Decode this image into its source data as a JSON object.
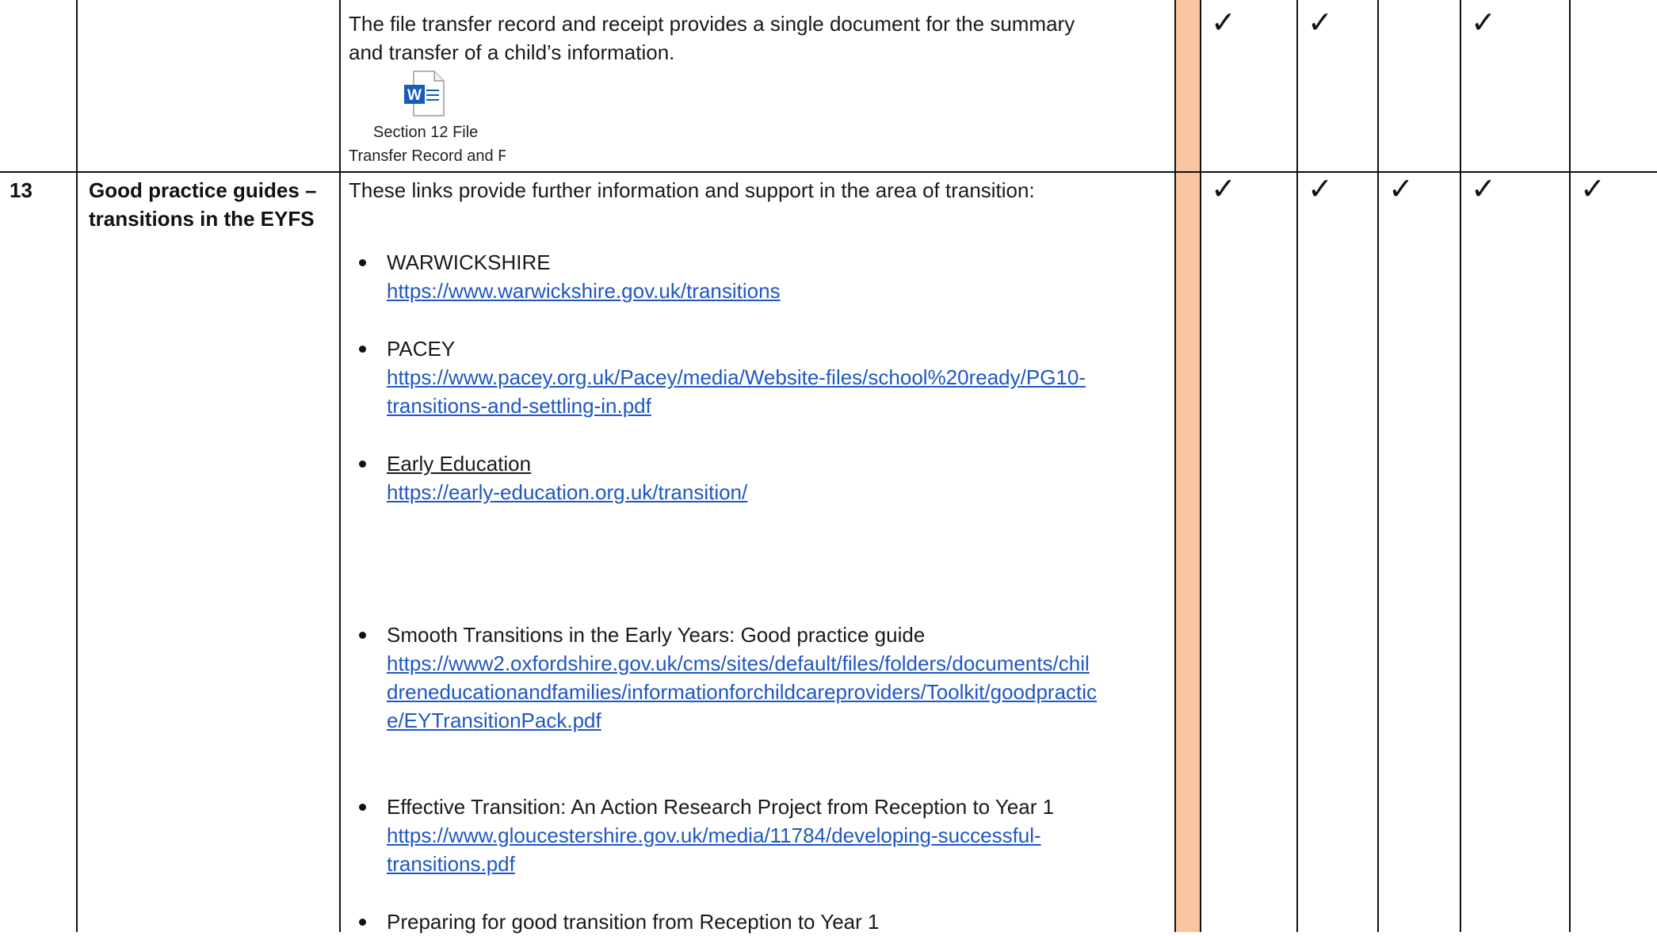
{
  "row12": {
    "description_line1": "The file transfer record and receipt provides a single document for the summary",
    "description_line2": "and transfer of a child’s information.",
    "attachment": {
      "icon": "word-document-icon",
      "caption_line1": "Section 12 File",
      "caption_line2": "Transfer Record and F"
    },
    "checks": [
      "✓",
      "✓",
      "",
      "✓",
      ""
    ]
  },
  "row13": {
    "number": "13",
    "title_line1": "Good practice guides –",
    "title_line2": "transitions in the EYFS",
    "intro": "These links provide further information and support in the area of transition:",
    "links": [
      {
        "label": "WARWICKSHIRE",
        "url_lines": [
          "https://www.warwickshire.gov.uk/transitions"
        ]
      },
      {
        "label": "PACEY",
        "url_lines": [
          "https://www.pacey.org.uk/Pacey/media/Website-files/school%20ready/PG10-",
          "transitions-and-settling-in.pdf"
        ]
      },
      {
        "label": "Early Education",
        "url_lines": [
          "https://early-education.org.uk/transition/"
        ]
      },
      {
        "label": "Smooth Transitions in the Early Years: Good practice guide",
        "url_lines": [
          "https://www2.oxfordshire.gov.uk/cms/sites/default/files/folders/documents/chil",
          "dreneducationandfamilies/informationforchildcareproviders/Toolkit/goodpractic",
          "e/EYTransitionPack.pdf"
        ]
      },
      {
        "label": "Effective Transition: An Action Research Project from Reception to Year 1",
        "url_lines": [
          "https://www.gloucestershire.gov.uk/media/11784/developing-successful-",
          "transitions.pdf"
        ]
      },
      {
        "label": "Preparing for good transition from Reception to Year 1",
        "url_lines": []
      }
    ],
    "checks": [
      "✓",
      "✓",
      "✓",
      "✓",
      "✓"
    ]
  },
  "colors": {
    "link": "#1f57c3",
    "highlight_column": "#f7c59f",
    "word_blue": "#185abd"
  }
}
